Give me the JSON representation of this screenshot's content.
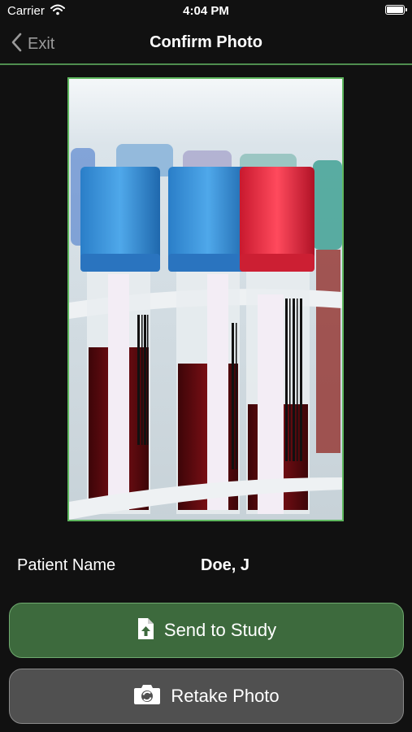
{
  "status_bar": {
    "carrier": "Carrier",
    "time": "4:04 PM"
  },
  "nav": {
    "back_label": "Exit",
    "title": "Confirm Photo"
  },
  "photo": {
    "subject": "blood sample test tubes with colored caps in a rack"
  },
  "patient": {
    "label": "Patient Name",
    "value": "Doe, J"
  },
  "actions": {
    "send_label": "Send to Study",
    "send_icon": "file-upload-icon",
    "retake_label": "Retake Photo",
    "retake_icon": "camera-icon"
  },
  "colors": {
    "accent": "#4f8e4f",
    "send_bg": "#3d6a3d",
    "retake_bg": "#505050",
    "background": "#111111"
  }
}
